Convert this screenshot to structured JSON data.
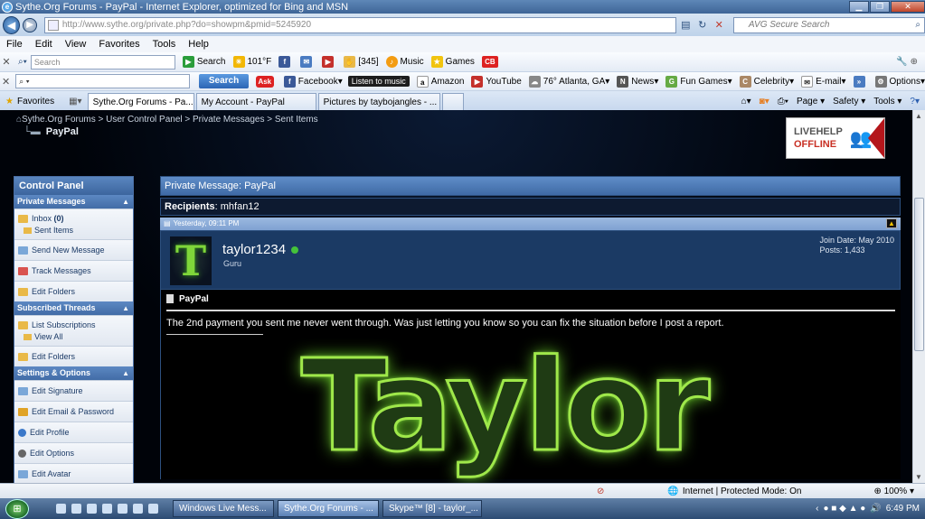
{
  "window": {
    "title": "Sythe.Org Forums - PayPal - Internet Explorer, optimized for Bing and MSN",
    "min": "▁",
    "max": "❐",
    "close": "✕"
  },
  "address": {
    "url": "http://www.sythe.org/private.php?do=showpm&pmid=5245920",
    "search_placeholder": "AVG Secure Search"
  },
  "menu": [
    "File",
    "Edit",
    "View",
    "Favorites",
    "Tools",
    "Help"
  ],
  "toolbar1": {
    "search_placeholder": "Search",
    "search_label": "Search",
    "weather": "101°F",
    "mail_count": "[345]",
    "music": "Music",
    "games": "Games"
  },
  "toolbar2": {
    "search_button": "Search",
    "facebook": "Facebook",
    "listen": "Listen to music",
    "amazon": "Amazon",
    "youtube": "YouTube",
    "weather": "76° Atlanta, GA",
    "news": "News",
    "fun_games": "Fun Games",
    "celebrity": "Celebrity",
    "email": "E-mail",
    "options": "Options"
  },
  "tabs": {
    "favorites": "Favorites",
    "items": [
      "Sythe.Org Forums - Pa...",
      "My Account - PayPal",
      "Pictures by taybojangles - ..."
    ],
    "right": [
      "Page ▾",
      "Safety ▾",
      "Tools ▾"
    ]
  },
  "breadcrumb": {
    "path": "Sythe.Org Forums > User Control Panel > Private Messages > Sent Items",
    "current": "PayPal"
  },
  "livehelp": {
    "line1": "LIVEHELP",
    "line2": "OFFLINE"
  },
  "sidebar": {
    "title": "Control Panel",
    "sections": [
      {
        "label": "Private Messages"
      },
      {
        "label": "Subscribed Threads"
      },
      {
        "label": "Settings & Options"
      }
    ],
    "inbox": "Inbox",
    "inbox_count": "(0)",
    "sent_items": "Sent Items",
    "send_new": "Send New Message",
    "track": "Track Messages",
    "edit_folders": "Edit Folders",
    "list_subs": "List Subscriptions",
    "view_all": "View All",
    "edit_folders2": "Edit Folders",
    "edit_signature": "Edit Signature",
    "edit_email": "Edit Email & Password",
    "edit_profile": "Edit Profile",
    "edit_options": "Edit Options",
    "edit_avatar": "Edit Avatar"
  },
  "pm": {
    "header_prefix": "Private Message",
    "header_title": "PayPal",
    "recipients_label": "Recipients",
    "recipient": "mhfan12",
    "timestamp": "Yesterday, 09:11 PM",
    "username": "taylor1234",
    "rank": "Guru",
    "join_date": "Join Date: May 2010",
    "posts": "Posts: 1,433",
    "post_title": "PayPal",
    "message": "The 2nd payment you sent me never went through. Was just letting you know so you can fix the situation before I post a report.",
    "banner": "Taylor",
    "avatar_letter": "T"
  },
  "status": {
    "zone": "Internet | Protected Mode: On",
    "zoom": "100%"
  },
  "taskbar": {
    "tasks": [
      "Windows Live Mess...",
      "Sythe.Org Forums - ...",
      "Skype™ [8] - taylor_..."
    ],
    "time": "6:49 PM"
  }
}
